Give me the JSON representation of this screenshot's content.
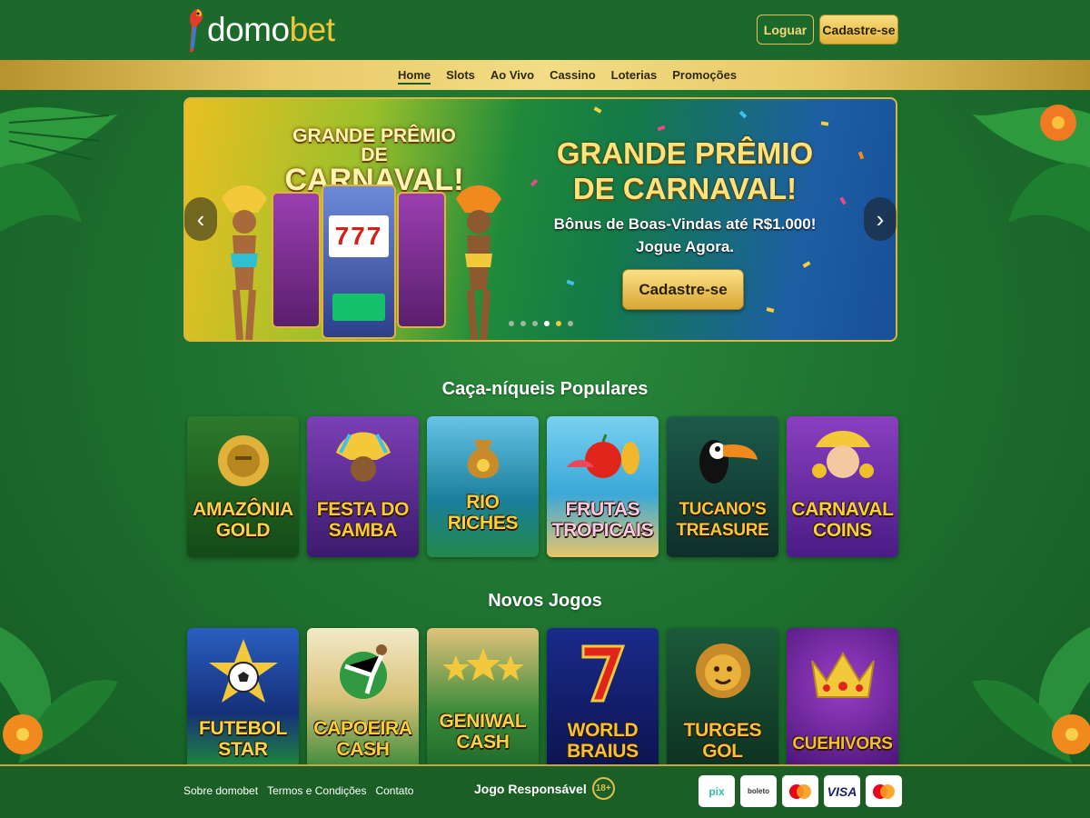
{
  "header": {
    "logo_main": "domo",
    "logo_accent": "bet",
    "login_label": "Loguar",
    "signup_label": "Cadastre-se"
  },
  "nav": {
    "items": [
      {
        "label": "Home",
        "active": true
      },
      {
        "label": "Slots"
      },
      {
        "label": "Ao Vivo"
      },
      {
        "label": "Cassino"
      },
      {
        "label": "Loterias"
      },
      {
        "label": "Promoções"
      }
    ]
  },
  "banner": {
    "art_title_line1": "GRANDE PRÊMIO DE",
    "art_title_line2": "CARNAVAL!",
    "title_line1": "GRANDE PRÊMIO",
    "title_line2": "DE CARNAVAL!",
    "subtitle_line1": "Bônus de Boas-Vindas até R$1.000!",
    "subtitle_line2": "Jogue Agora.",
    "cta_label": "Cadastre-se",
    "slot_reels": "777",
    "slide_count": 6,
    "active_slide": 4
  },
  "popular": {
    "title": "Caça-níqueis Populares",
    "games": [
      {
        "line1": "AMAZÔNIA",
        "line2": "GOLD",
        "color": "#f7d54a"
      },
      {
        "line1": "FESTA DO",
        "line2": "SAMBA",
        "color": "#f8c93a"
      },
      {
        "line1": "RIO",
        "line2": "RICHES",
        "color": "#f6d13c"
      },
      {
        "line1": "FRUTAS",
        "line2": "TROPICAIS",
        "color": "#f6c9e6"
      },
      {
        "line1": "TUCANO'S",
        "line2": "TREASURE",
        "color": "#f5c83b"
      },
      {
        "line1": "CARNAVAL",
        "line2": "COINS",
        "color": "#f8cf3c"
      }
    ]
  },
  "newgames": {
    "title": "Novos Jogos",
    "games": [
      {
        "line1": "FUTEBOL",
        "line2": "STAR",
        "color": "#f6d64a"
      },
      {
        "line1": "CAPOEIRA",
        "line2": "CASH",
        "color": "#f7cf3f"
      },
      {
        "line1": "GENIWAL",
        "line2": "CASH",
        "color": "#f8d349"
      },
      {
        "line1": "WORLD",
        "line2": "BRAIUS",
        "color": "#f3c13c"
      },
      {
        "line1": "TURGES",
        "line2": "GOL",
        "color": "#f3c13c"
      },
      {
        "line1": "CUEHIVORS",
        "line2": "",
        "color": "#f2be3a"
      }
    ]
  },
  "footer": {
    "links": [
      "Sobre domobet",
      "Termos e Condições",
      "Contato"
    ],
    "responsible": "Jogo Responsável",
    "age_badge": "18+",
    "payments": [
      "pix",
      "boleto",
      "mastercard",
      "VISA",
      "mastercard"
    ]
  }
}
